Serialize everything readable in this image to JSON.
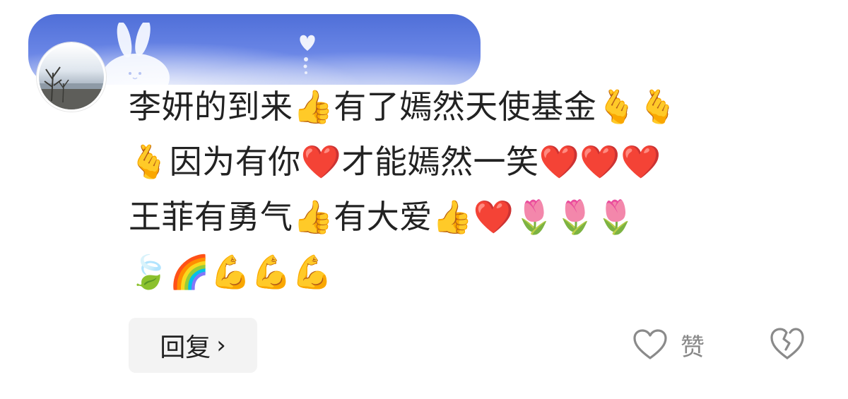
{
  "comment": {
    "lines": [
      "李妍的到来👍有了嫣然天使基金🫰🫰",
      "🫰因为有你❤️才能嫣然一笑❤️❤️❤️",
      "王菲有勇气👍有大爱👍❤️🌷🌷🌷",
      "🍃🌈💪💪💪"
    ]
  },
  "actions": {
    "reply_label": "回复",
    "reply_chevron": "›",
    "like_label": "赞"
  },
  "icons": {
    "like": "heart-outline-icon",
    "dislike": "broken-heart-icon",
    "reply": "chevron-right-icon"
  },
  "colors": {
    "text": "#222222",
    "muted": "#888888",
    "button_bg": "#f3f3f3",
    "banner": "#5b79dd"
  }
}
